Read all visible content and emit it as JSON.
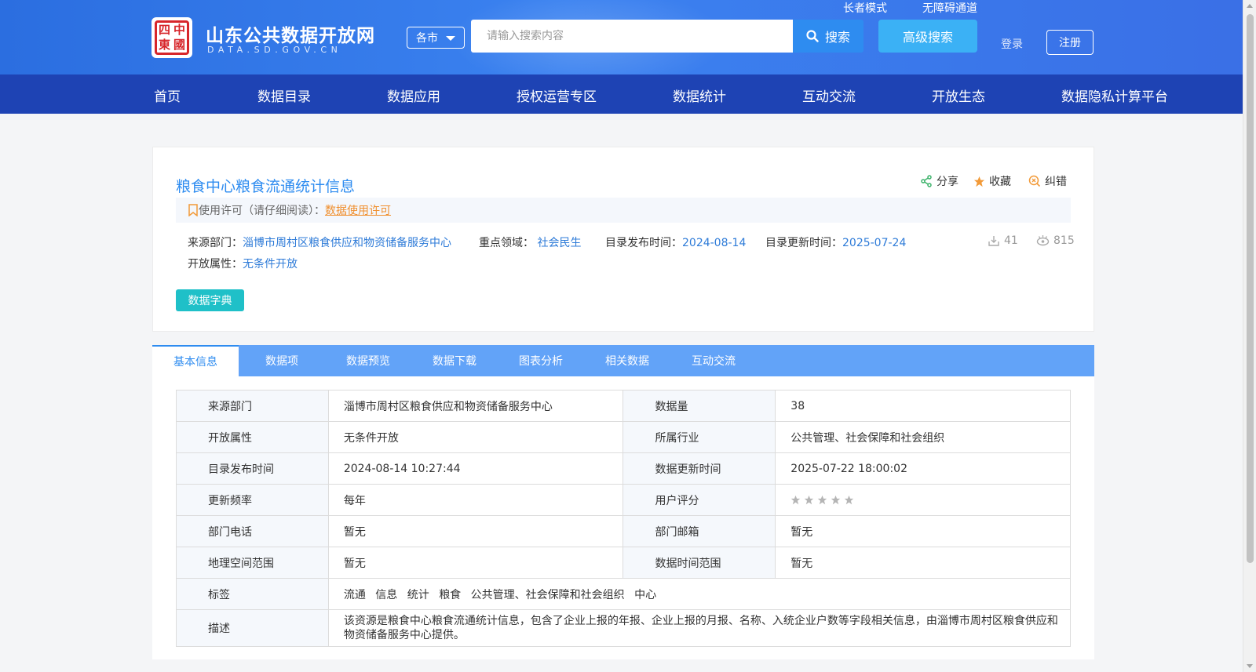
{
  "header": {
    "site_title": "山东公共数据开放网",
    "site_subtitle": "DATA.SD.GOV.CN",
    "logo_seal_chars": [
      "四",
      "中",
      "東",
      "國"
    ],
    "elder_mode": "长者模式",
    "accessibility": "无障碍通道",
    "city_select": "各市",
    "search_placeholder": "请输入搜索内容",
    "search_label": "搜索",
    "advanced_search": "高级搜索",
    "login": "登录",
    "register": "注册"
  },
  "nav": [
    "首页",
    "数据目录",
    "数据应用",
    "授权运营专区",
    "数据统计",
    "互动交流",
    "开放生态",
    "数据隐私计算平台"
  ],
  "resource": {
    "title": "粮食中心粮食流通统计信息",
    "actions": {
      "share": "分享",
      "collect": "收藏",
      "report": "纠错"
    },
    "license_prefix": "使用许可（请仔细阅读）：",
    "license_link": "数据使用许可",
    "source_dept_label": "来源部门：",
    "source_dept": "淄博市周村区粮食供应和物资储备服务中心",
    "field_label": "重点领域：",
    "field": "社会民生",
    "publish_label": "目录发布时间：",
    "publish_date": "2024-08-14",
    "update_label": "目录更新时间：",
    "update_date": "2025-07-24",
    "open_attr_label": "开放属性：",
    "open_attr": "无条件开放",
    "downloads": "41",
    "views": "815",
    "dict_button": "数据字典"
  },
  "tabs": [
    "基本信息",
    "数据项",
    "数据预览",
    "数据下载",
    "图表分析",
    "相关数据",
    "互动交流"
  ],
  "info": {
    "rows": [
      {
        "k1": "来源部门",
        "v1": "淄博市周村区粮食供应和物资储备服务中心",
        "k2": "数据量",
        "v2": "38"
      },
      {
        "k1": "开放属性",
        "v1": "无条件开放",
        "k2": "所属行业",
        "v2": "公共管理、社会保障和社会组织"
      },
      {
        "k1": "目录发布时间",
        "v1": "2024-08-14 10:27:44",
        "k2": "数据更新时间",
        "v2": "2025-07-22 18:00:02"
      },
      {
        "k1": "更新频率",
        "v1": "每年",
        "k2": "用户评分",
        "v2": ""
      },
      {
        "k1": "部门电话",
        "v1": "暂无",
        "k2": "部门邮箱",
        "v2": "暂无"
      },
      {
        "k1": "地理空间范围",
        "v1": "暂无",
        "k2": "数据时间范围",
        "v2": "暂无"
      }
    ],
    "tags_label": "标签",
    "tags": [
      "流通",
      "信息",
      "统计",
      "粮食",
      "公共管理、社会保障和社会组织",
      "中心"
    ],
    "desc_label": "描述",
    "desc": "该资源是粮食中心粮食流通统计信息，包含了企业上报的年报、企业上报的月报、名称、入统企业户数等字段相关信息，由淄博市周村区粮食供应和物资储备服务中心提供。",
    "rating": 0
  },
  "colors": {
    "header_blue": "#2b6ee0",
    "nav_blue": "#1e43b4",
    "accent": "#2e8cf0",
    "link_orange": "#f08f2e",
    "dict_teal": "#1fc0c8"
  }
}
